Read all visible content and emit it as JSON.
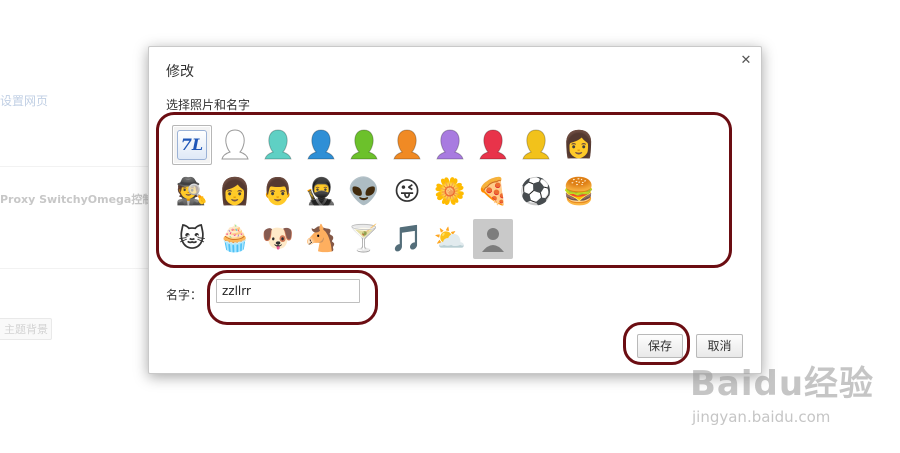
{
  "background_page": {
    "link_text": "设置网页",
    "extension_text": "Proxy SwitchyOmega控制",
    "theme_button_label": "主题背景"
  },
  "dialog": {
    "title": "修改",
    "close_icon": "close-icon",
    "section_label": "选择照片和名字",
    "avatars": [
      {
        "name": "app-default-avatar",
        "glyph": "7L",
        "selected": true
      },
      {
        "name": "white-silhouette-avatar",
        "color": "#ffffff"
      },
      {
        "name": "teal-silhouette-avatar",
        "color": "#5fd0c4"
      },
      {
        "name": "blue-silhouette-avatar",
        "color": "#2e8fd6"
      },
      {
        "name": "green-silhouette-avatar",
        "color": "#6cc12b"
      },
      {
        "name": "orange-silhouette-avatar",
        "color": "#f08a24"
      },
      {
        "name": "purple-silhouette-avatar",
        "color": "#a87be0"
      },
      {
        "name": "red-silhouette-avatar",
        "color": "#e8334a"
      },
      {
        "name": "yellow-silhouette-avatar",
        "color": "#f2c21b"
      },
      {
        "name": "businesswoman-avatar",
        "glyph": "👩"
      },
      {
        "name": "spy-avatar",
        "glyph": "🕵"
      },
      {
        "name": "sunglasses-woman-avatar",
        "glyph": "👩"
      },
      {
        "name": "businessman-avatar",
        "glyph": "👨"
      },
      {
        "name": "ninja-avatar",
        "glyph": "🥷"
      },
      {
        "name": "alien-avatar",
        "glyph": "👽"
      },
      {
        "name": "smiley-avatar",
        "glyph": "😜"
      },
      {
        "name": "flower-avatar",
        "glyph": "🌼"
      },
      {
        "name": "pizza-avatar",
        "glyph": "🍕"
      },
      {
        "name": "soccer-ball-avatar",
        "glyph": "⚽"
      },
      {
        "name": "burger-avatar",
        "glyph": "🍔"
      },
      {
        "name": "cat-avatar",
        "glyph": "🐱"
      },
      {
        "name": "cupcake-avatar",
        "glyph": "🧁"
      },
      {
        "name": "dog-avatar",
        "glyph": "🐶"
      },
      {
        "name": "horse-avatar",
        "glyph": "🐴"
      },
      {
        "name": "cocktail-avatar",
        "glyph": "🍸"
      },
      {
        "name": "music-note-avatar",
        "glyph": "🎵"
      },
      {
        "name": "sun-cloud-avatar",
        "glyph": "⛅"
      },
      {
        "name": "generic-person-avatar",
        "color": "#c9c9c9"
      }
    ],
    "name_label": "名字：",
    "name_value": "zzllrr",
    "save_label": "保存",
    "cancel_label": "取消"
  },
  "annotation_color": "#6b0d12",
  "watermark": {
    "logo": "Baidu经验",
    "url": "jingyan.baidu.com"
  }
}
